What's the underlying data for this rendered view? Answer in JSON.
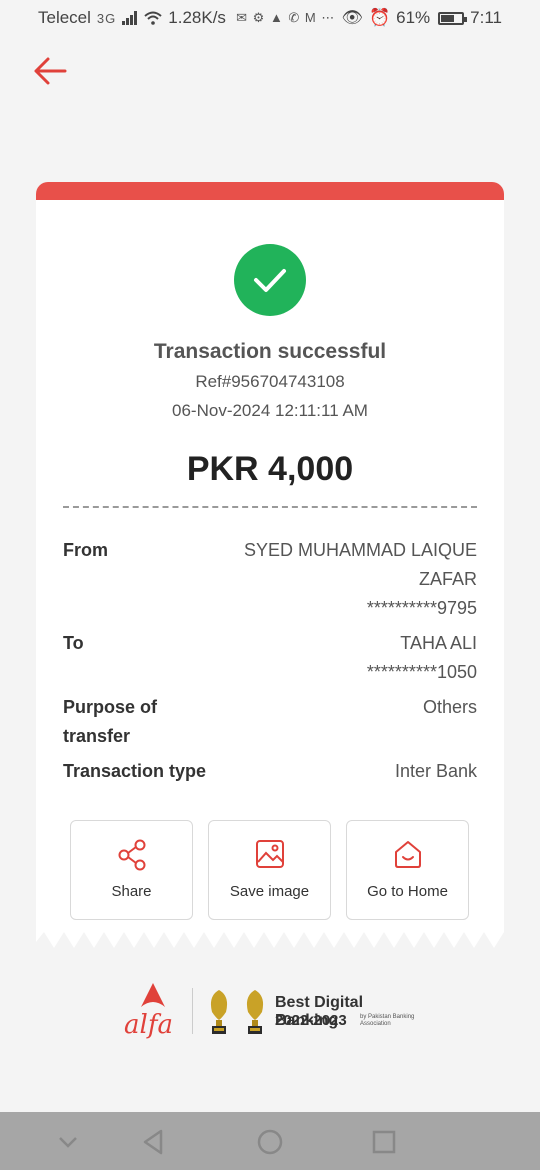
{
  "status_bar": {
    "carrier": "Telecel",
    "network": "3G",
    "speed": "1.28K/s",
    "battery": "61%",
    "time": "7:11"
  },
  "receipt": {
    "title": "Transaction successful",
    "reference": "Ref#956704743108",
    "datetime": "06-Nov-2024 12:11:11 AM",
    "amount": "PKR 4,000",
    "details": {
      "from_label": "From",
      "from_name_line1": "SYED MUHAMMAD LAIQUE",
      "from_name_line2": "ZAFAR",
      "from_account": "**********9795",
      "to_label": "To",
      "to_name": "TAHA ALI",
      "to_account": "**********1050",
      "purpose_label_line1": "Purpose of",
      "purpose_label_line2": "transfer",
      "purpose_value": "Others",
      "type_label": "Transaction type",
      "type_value": "Inter Bank"
    },
    "actions": {
      "share": "Share",
      "save_image": "Save image",
      "go_home": "Go to Home"
    }
  },
  "footer": {
    "logo_text": "alfa",
    "award_title": "Best Digital Banking",
    "award_year": "2022-2023",
    "award_by": "by Pakistan Banking Association"
  },
  "colors": {
    "accent": "#e8504a",
    "success": "#21b35a"
  }
}
